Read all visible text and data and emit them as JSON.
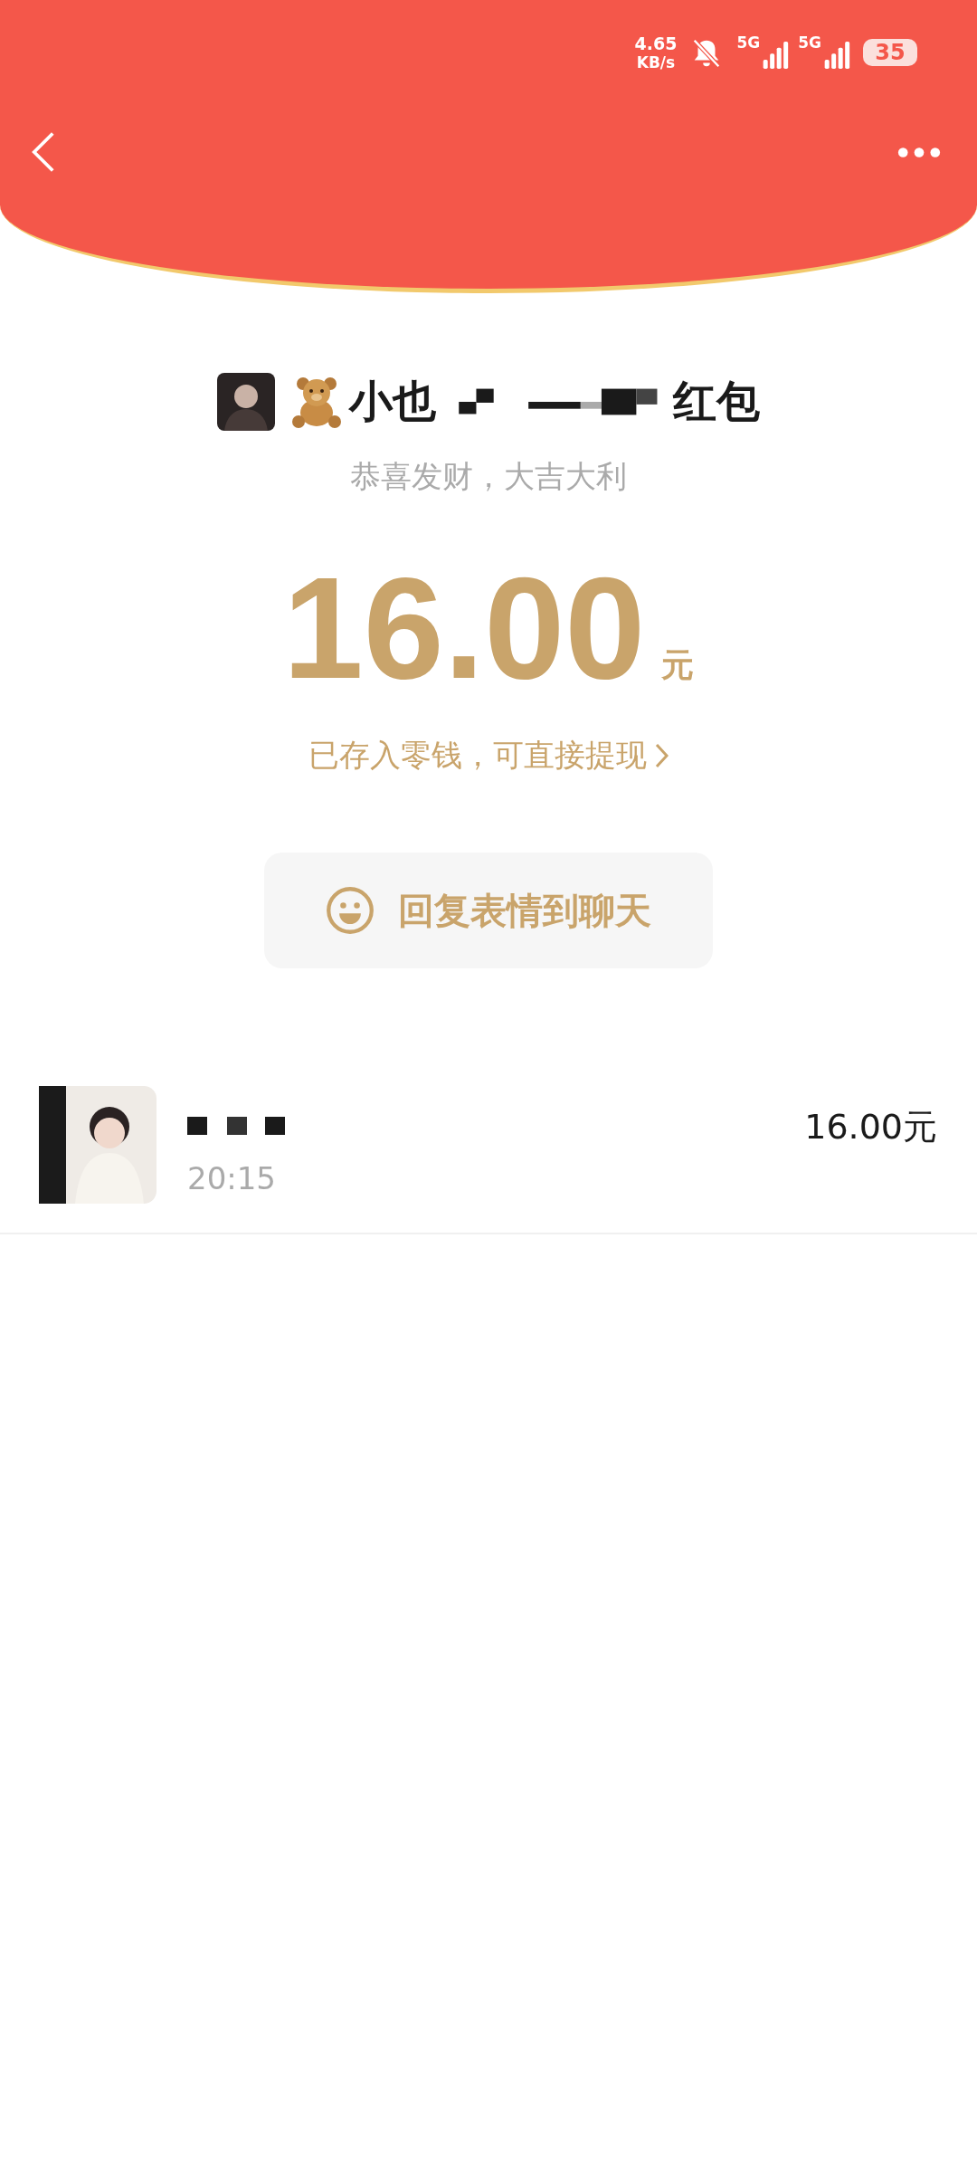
{
  "status_bar": {
    "speed": "4.65",
    "speed_unit": "KB/s",
    "networks": [
      {
        "label": "5G"
      },
      {
        "label": "5G"
      }
    ],
    "battery": "35"
  },
  "packet": {
    "title_start": "小也",
    "title_end": "红包",
    "greeting": "恭喜发财，大吉大利",
    "amount": "16.00",
    "currency": "元",
    "note": "已存入零钱，可直接提现",
    "reply_button": "回复表情到聊天"
  },
  "records": [
    {
      "time": "20:15",
      "amount": "16.00元"
    }
  ]
}
